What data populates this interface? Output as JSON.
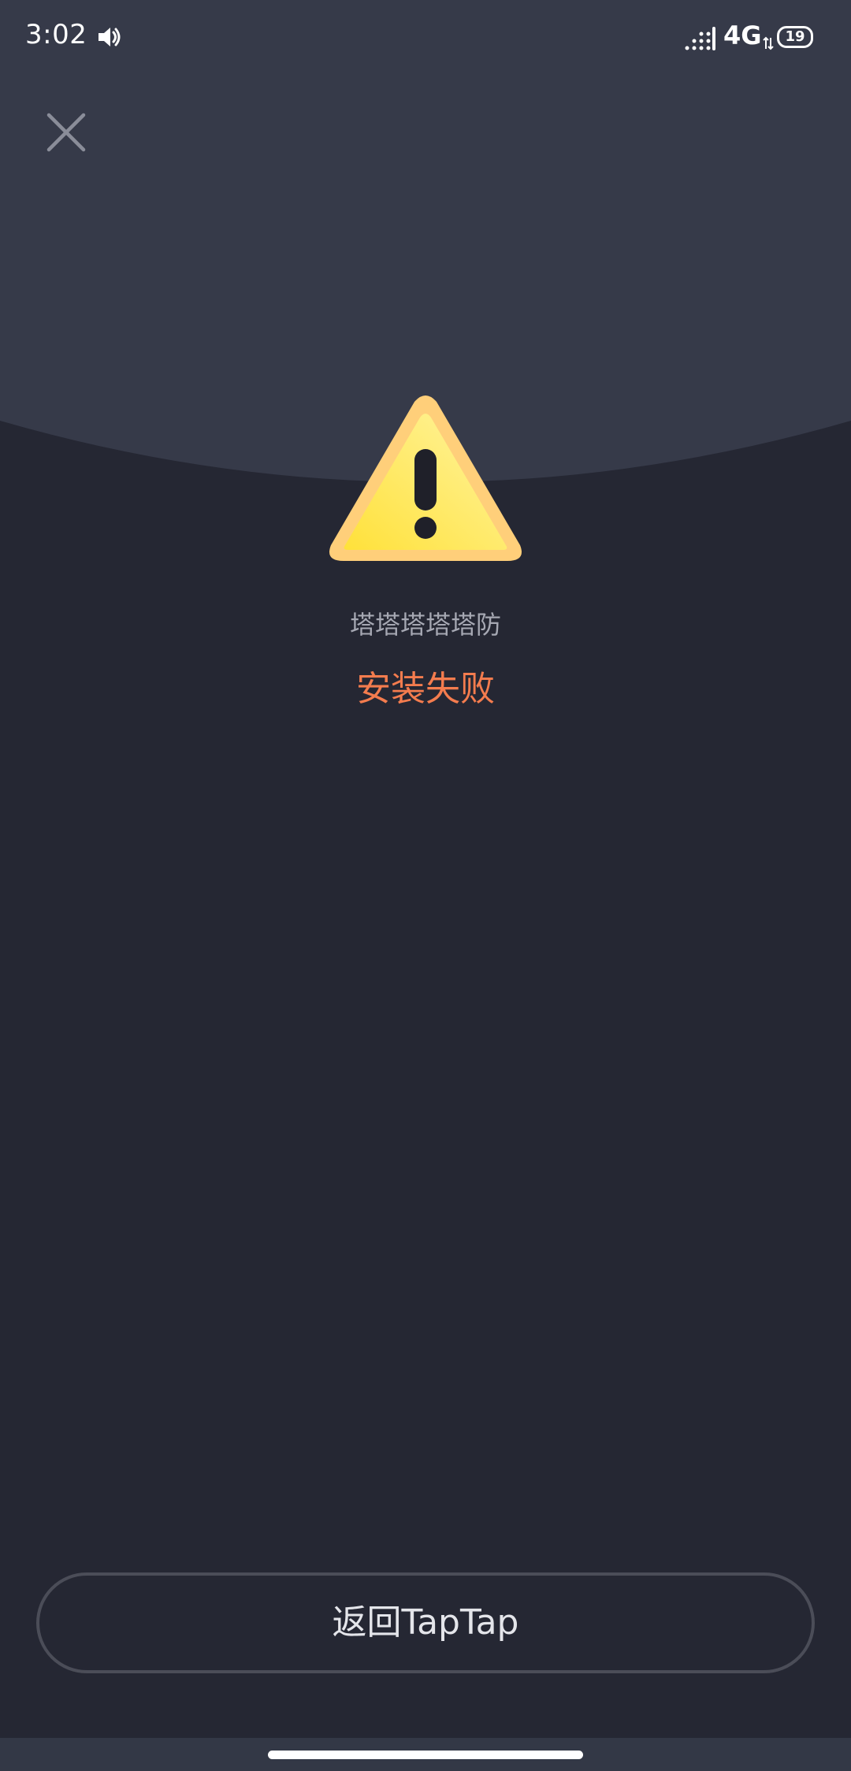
{
  "status_bar": {
    "time": "3:02",
    "network": "4G",
    "battery": "19",
    "icons": [
      "volume-icon",
      "signal-icon",
      "data-arrows-icon",
      "battery-icon"
    ]
  },
  "header": {
    "close_icon": "close-icon"
  },
  "result": {
    "icon": "warning-icon",
    "app_name": "塔塔塔塔塔防",
    "message": "安装失败"
  },
  "actions": {
    "return_label": "返回TapTap"
  },
  "colors": {
    "background": "#252733",
    "header_background": "#363a49",
    "error_text": "#f47c4e",
    "secondary_text": "#a6a8b3",
    "warning_yellow": "#ffe55c",
    "warning_border": "#ffcf7a"
  }
}
